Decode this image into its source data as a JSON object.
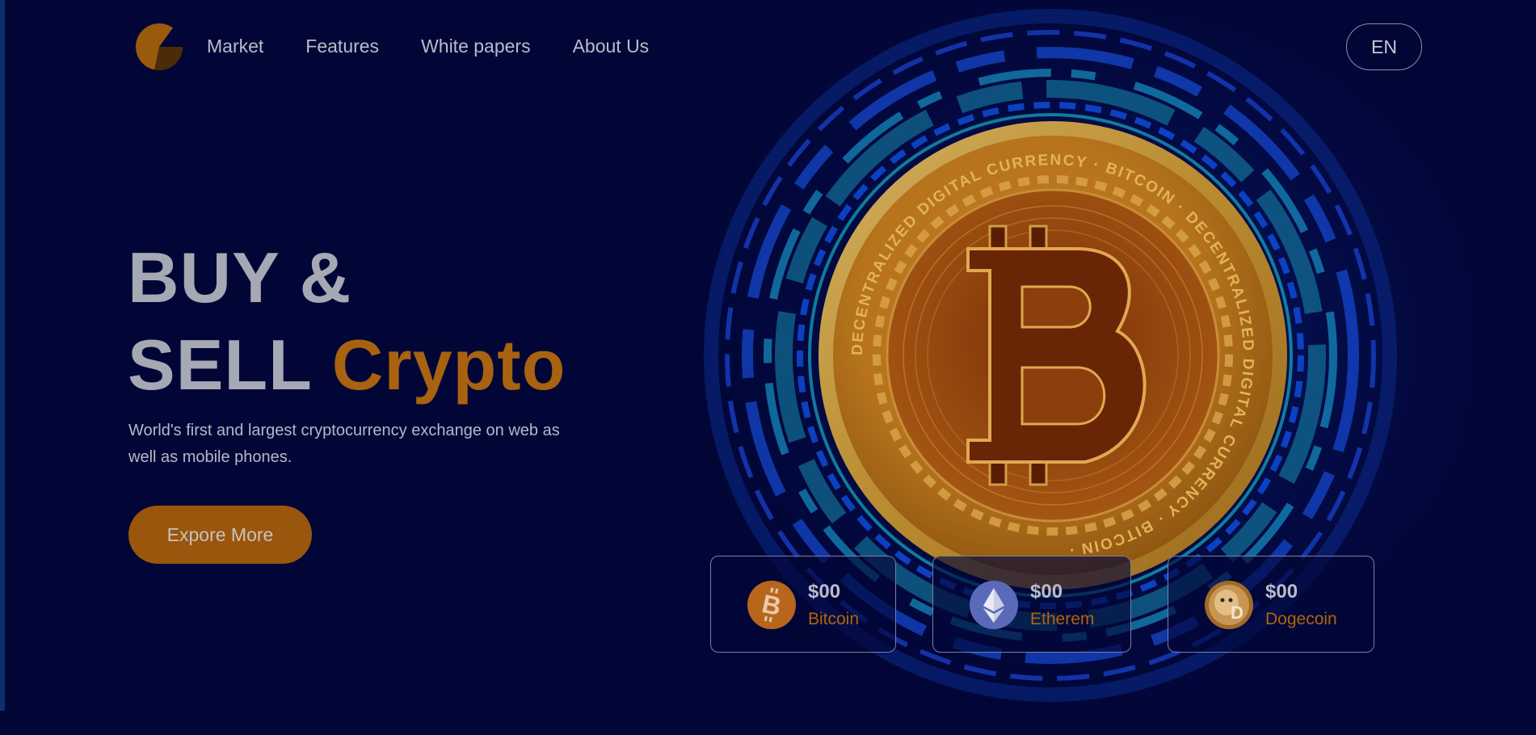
{
  "header": {
    "nav": [
      "Market",
      "Features",
      "White papers",
      "About Us"
    ],
    "language": "EN"
  },
  "hero": {
    "title_line1": "BUY &",
    "title_line2_a": "SELL ",
    "title_line2_b": "Crypto",
    "subtitle": "World's first and largest cryptocurrency exchange on web as well as mobile phones.",
    "cta_label": "Expore More"
  },
  "coins": [
    {
      "price": "$00",
      "name": "Bitcoin"
    },
    {
      "price": "$00",
      "name": "Etherem"
    },
    {
      "price": "$00",
      "name": "Dogecoin"
    }
  ],
  "coin_art_text": {
    "ring": "DECENTRALIZED DIGITAL CURRENCY · BITCOIN · DECENTRALIZED DIGITAL CURRENCY · BITCOIN ·"
  },
  "colors": {
    "background": "#020637",
    "accent": "#a96210",
    "button": "#9a560c",
    "coin_gold": "#c88a28",
    "glow_blue": "#1a5cff",
    "glow_cyan": "#19c7d8"
  },
  "icons": {
    "logo": "brand-logo-icon",
    "bitcoin": "bitcoin-icon",
    "ethereum": "ethereum-icon",
    "dogecoin": "dogecoin-icon"
  }
}
